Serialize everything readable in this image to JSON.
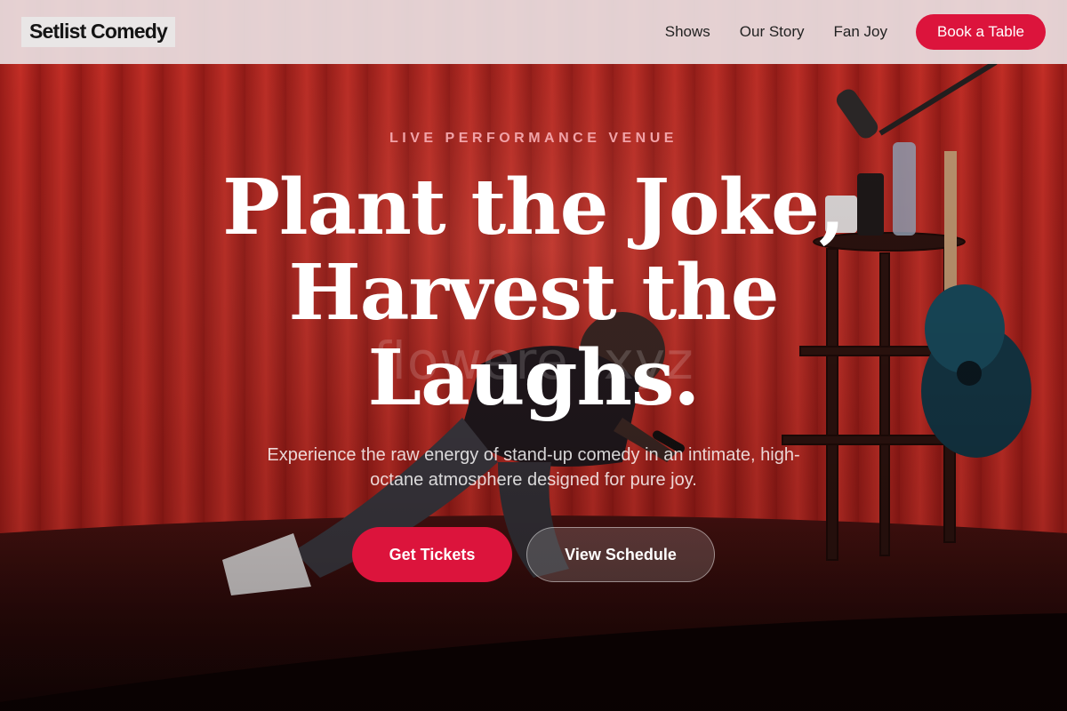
{
  "header": {
    "brand": "Setlist Comedy",
    "nav": [
      {
        "label": "Shows"
      },
      {
        "label": "Our Story"
      },
      {
        "label": "Fan Joy"
      }
    ],
    "cta_label": "Book a Table"
  },
  "hero": {
    "eyebrow": "LIVE PERFORMANCE VENUE",
    "headline_lines": [
      "Plant the Joke,",
      "Harvest the",
      "Laughs."
    ],
    "subtitle": "Experience the raw energy of stand-up comedy in an intimate, high-octane atmosphere designed for pure joy.",
    "primary_cta": "Get Tickets",
    "secondary_cta": "View Schedule",
    "watermark": "flowere            .xyz"
  },
  "colors": {
    "accent": "#dc143c",
    "eyebrow": "#f1a3a8",
    "curtain": "#c9261f"
  },
  "icons": {
    "hero_image": "comedian-on-stage-photo"
  }
}
